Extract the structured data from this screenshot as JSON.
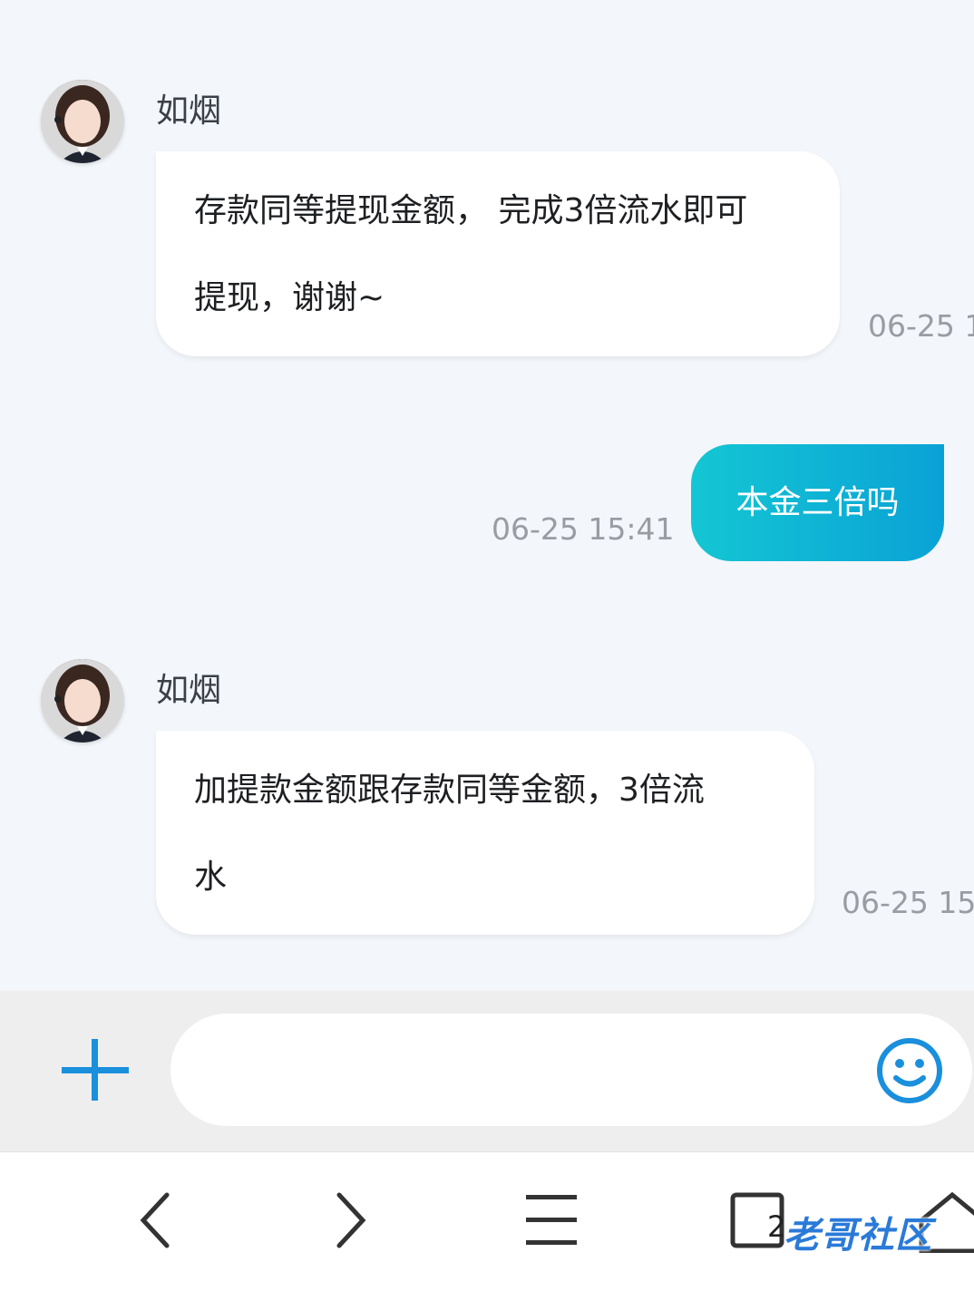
{
  "messages": [
    {
      "sender": "如烟",
      "lines": [
        "存款同等提现金额， 完成3倍流水即可",
        "提现，谢谢~"
      ],
      "time": "06-25 1"
    },
    {
      "text": "本金三倍吗",
      "time": "06-25 15:41"
    },
    {
      "sender": "如烟",
      "lines": [
        "加提款金额跟存款同等金额，3倍流",
        "水"
      ],
      "time": "06-25 15:"
    }
  ],
  "composer": {
    "plus_icon": "plus-icon",
    "placeholder": "",
    "emoji_icon": "smiley-icon",
    "accent": "#1a8fdc"
  },
  "browser_nav": {
    "back_icon": "chevron-left-icon",
    "forward_icon": "chevron-right-icon",
    "menu_icon": "hamburger-icon",
    "tabs_icon": "tabs-icon",
    "tab_count": "2",
    "home_icon": "home-icon"
  },
  "watermark": "老哥社区",
  "colors": {
    "background": "#f3f6fa",
    "bubble_out_start": "#14c6d3",
    "bubble_out_end": "#0aa2d6"
  }
}
